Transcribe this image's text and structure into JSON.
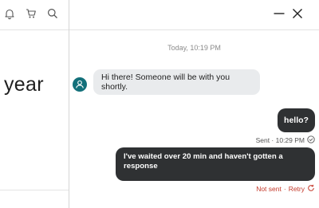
{
  "page": {
    "heading_fragment": "year"
  },
  "toolbar": {
    "icons": [
      "bell-icon",
      "cart-icon",
      "search-icon"
    ]
  },
  "chat": {
    "header_icons": [
      "minimize-icon",
      "close-icon"
    ],
    "timestamp": "Today, 10:19 PM",
    "messages": [
      {
        "from": "agent",
        "text": "Hi there! Someone will be with you shortly."
      },
      {
        "from": "user",
        "text": "hello?",
        "status": "Sent · 10:29 PM"
      },
      {
        "from": "user",
        "text": "I've waited over 20 min and haven't gotten a response",
        "status": "Not sent",
        "action": "Retry"
      }
    ]
  },
  "colors": {
    "avatar": "#13707a",
    "agent_bubble": "#e9ebed",
    "user_bubble": "#2f3133",
    "error": "#c4392b"
  }
}
